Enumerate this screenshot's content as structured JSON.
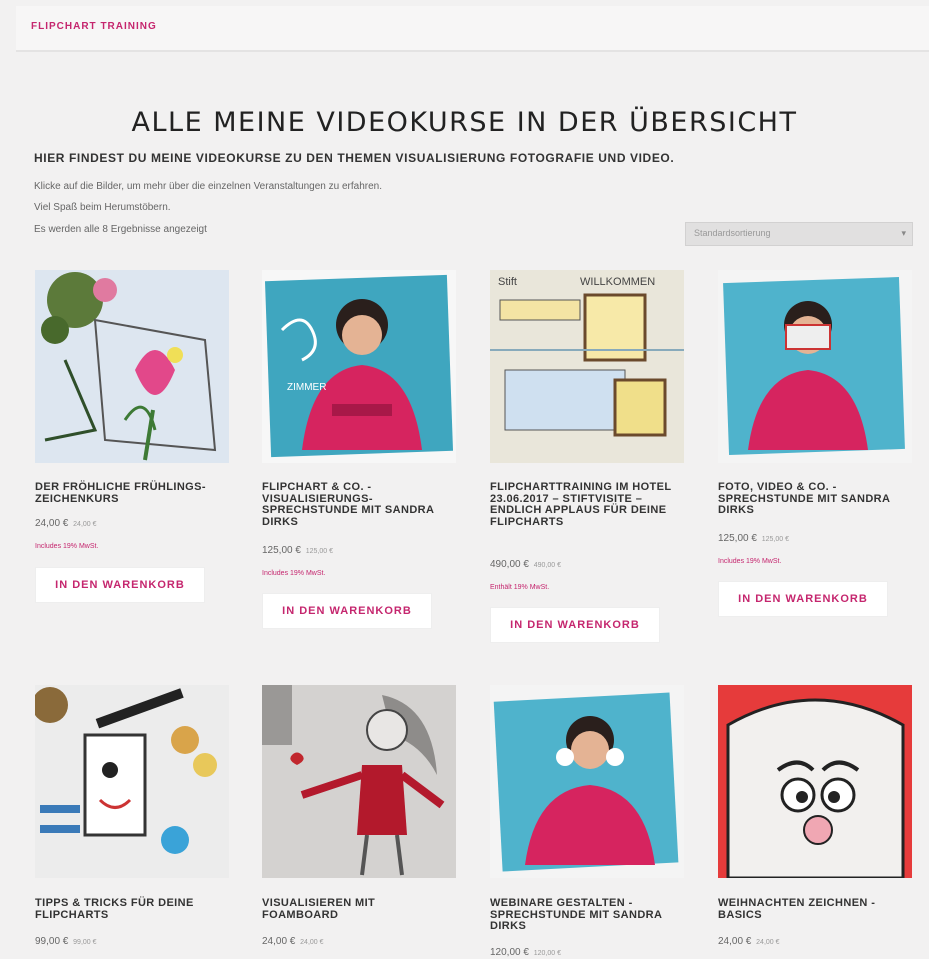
{
  "site": {
    "brand": "FLIPCHART TRAINING"
  },
  "page": {
    "title": "ALLE MEINE VIDEOKURSE IN DER ÜBERSICHT",
    "subtitle": "HIER FINDEST DU MEINE VIDEOKURSE ZU DEN THEMEN VISUALISIERUNG FOTOGRAFIE UND VIDEO.",
    "intro_line1": "Klicke auf die Bilder, um mehr über die einzelnen Veranstaltungen zu erfahren.",
    "intro_line2": "Viel Spaß beim Herumstöbern.",
    "result_count": "Es werden alle 8 Ergebnisse angezeigt"
  },
  "sort": {
    "selected": "Standardsortierung"
  },
  "products": [
    {
      "title": "DER FRÖHLICHE FRÜHLINGS-ZEICHENKURS",
      "price": "24,00 €",
      "price_small": "24,00 €",
      "tax": "Includes 19% MwSt.",
      "button": "IN DEN WARENKORB"
    },
    {
      "title": "FLIPCHART & CO. - VISUALISIERUNGS-SPRECHSTUNDE MIT SANDRA DIRKS",
      "price": "125,00 €",
      "price_small": "125,00 €",
      "tax": "Includes 19% MwSt.",
      "button": "IN DEN WARENKORB"
    },
    {
      "title": "FLIPCHARTTRAINING IM HOTEL 23.06.2017 – STIFTVISITE – ENDLICH APPLAUS FÜR DEINE FLIPCHARTS",
      "price": "490,00 €",
      "price_small": "490,00 €",
      "tax": "Enthält 19% MwSt.",
      "button": "IN DEN WARENKORB"
    },
    {
      "title": "FOTO, VIDEO & CO. - SPRECHSTUNDE MIT SANDRA DIRKS",
      "price": "125,00 €",
      "price_small": "125,00 €",
      "tax": "Includes 19% MwSt.",
      "button": "IN DEN WARENKORB"
    },
    {
      "title": "TIPPS & TRICKS FÜR DEINE FLIPCHARTS",
      "price": "99,00 €",
      "price_small": "99,00 €"
    },
    {
      "title": "VISUALISIEREN MIT FOAMBOARD",
      "price": "24,00 €",
      "price_small": "24,00 €"
    },
    {
      "title": "WEBINARE GESTALTEN - SPRECHSTUNDE MIT SANDRA DIRKS",
      "price": "120,00 €",
      "price_small": "120,00 €"
    },
    {
      "title": "WEIHNACHTEN ZEICHNEN - BASICS",
      "price": "24,00 €",
      "price_small": "24,00 €"
    }
  ],
  "colors": {
    "accent": "#c5266e",
    "background": "#f2f1f1",
    "text": "#333333"
  }
}
